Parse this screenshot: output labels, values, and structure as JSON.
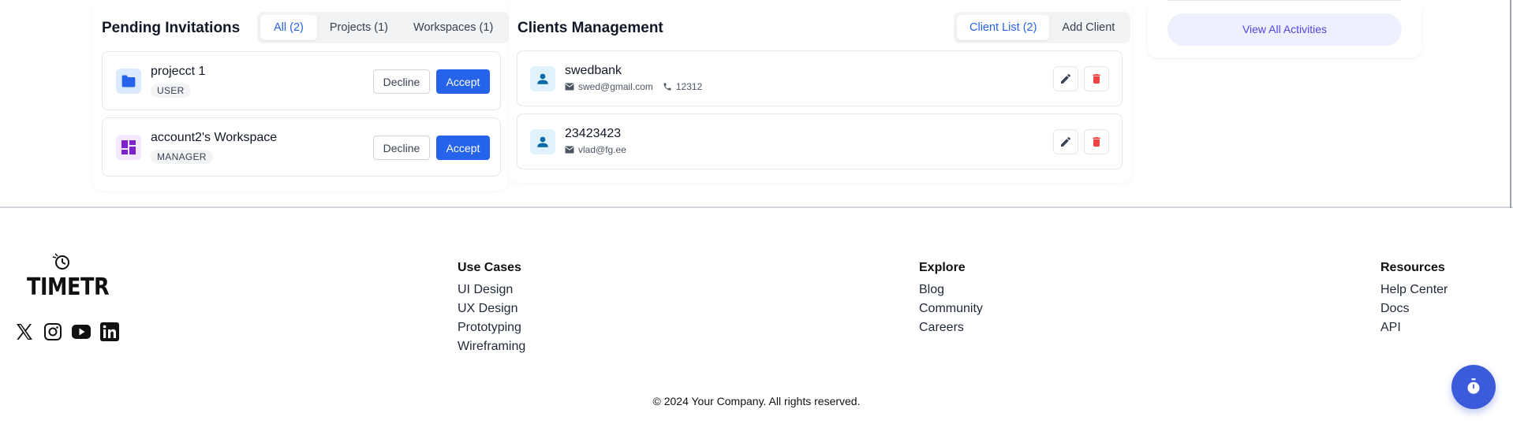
{
  "pending": {
    "title": "Pending Invitations",
    "tabs": [
      {
        "label": "All (2)",
        "active": true
      },
      {
        "label": "Projects (1)",
        "active": false
      },
      {
        "label": "Workspaces (1)",
        "active": false
      }
    ],
    "invites": [
      {
        "name": "projecct 1",
        "role": "USER",
        "icon": "folder-icon",
        "decline": "Decline",
        "accept": "Accept"
      },
      {
        "name": "account2's Workspace",
        "role": "MANAGER",
        "icon": "workspace-icon",
        "decline": "Decline",
        "accept": "Accept"
      }
    ]
  },
  "clients": {
    "title": "Clients Management",
    "tabs": [
      {
        "label": "Client List (2)",
        "active": true
      },
      {
        "label": "Add Client",
        "active": false
      }
    ],
    "list": [
      {
        "name": "swedbank",
        "email": "swed@gmail.com",
        "phone": "12312"
      },
      {
        "name": "23423423",
        "email": "vlad@fg.ee",
        "phone": ""
      }
    ]
  },
  "activities": {
    "view_all": "View All Activities"
  },
  "footer": {
    "logo_text": "TIMETR",
    "social": [
      "x-icon",
      "instagram-icon",
      "youtube-icon",
      "linkedin-icon"
    ],
    "columns": [
      {
        "title": "Use Cases",
        "links": [
          "UI Design",
          "UX Design",
          "Prototyping",
          "Wireframing"
        ]
      },
      {
        "title": "Explore",
        "links": [
          "Blog",
          "Community",
          "Careers"
        ]
      },
      {
        "title": "Resources",
        "links": [
          "Help Center",
          "Docs",
          "API"
        ]
      }
    ],
    "copyright": "© 2024 Your Company. All rights reserved."
  },
  "colors": {
    "primary": "#2563eb",
    "danger": "#ef4444",
    "fab": "#3b5bdb"
  }
}
